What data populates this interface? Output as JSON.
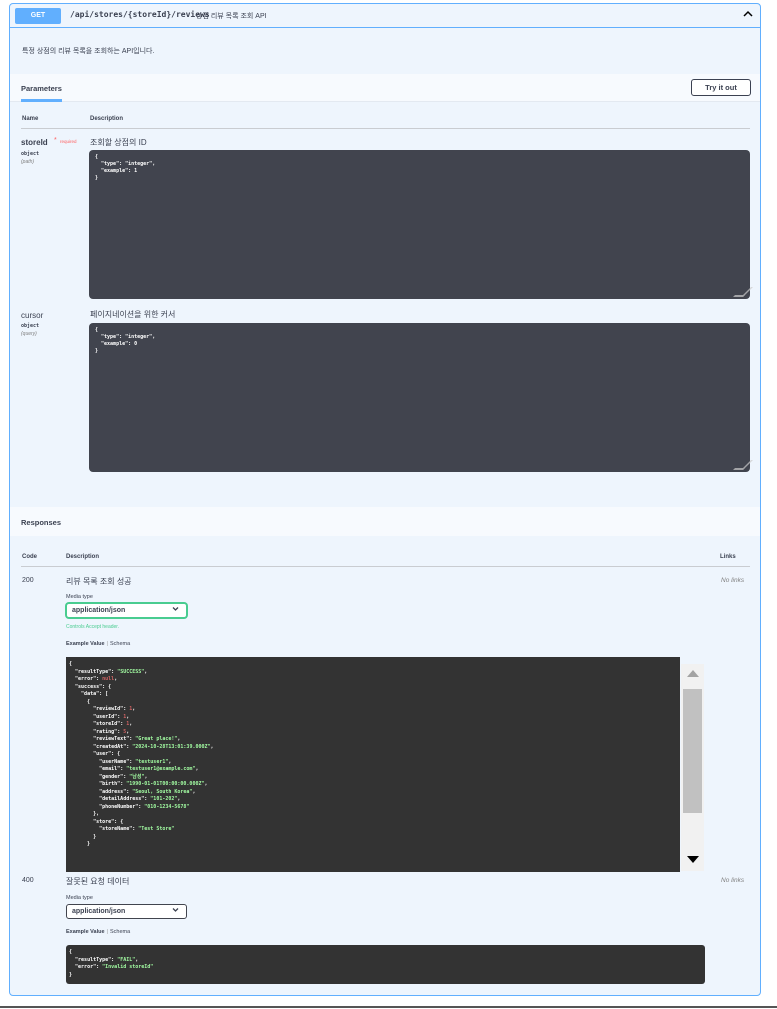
{
  "endpoint": {
    "method": "GET",
    "path": "/api/stores/{storeId}/reviews",
    "summary": "상점 리뷰 목록 조회 API",
    "description": "특정 상점의 리뷰 목록을 조회하는 API입니다."
  },
  "parameters": {
    "tab_label": "Parameters",
    "try_button": "Try it out",
    "col_name": "Name",
    "col_description": "Description",
    "items": [
      {
        "name": "storeId",
        "required_marker": "*",
        "required_label": "required",
        "type": "object",
        "in": "(path)",
        "description": "조회할 상점의 ID",
        "schema_lines": [
          "{",
          "  \"type\": \"integer\",",
          "  \"example\": 1",
          "}"
        ]
      },
      {
        "name": "cursor",
        "type": "object",
        "in": "(query)",
        "description": "페이지네이션을 위한 커서",
        "schema_lines": [
          "{",
          "  \"type\": \"integer\",",
          "  \"example\": 0",
          "}"
        ]
      }
    ]
  },
  "responses": {
    "title": "Responses",
    "col_code": "Code",
    "col_description": "Description",
    "col_links": "Links",
    "items": [
      {
        "code": "200",
        "description": "리뷰 목록 조회 성공",
        "links": "No links",
        "media_type_label": "Media type",
        "media_type": "application/json",
        "accept_note": "Controls Accept header.",
        "example_tab": "Example Value",
        "schema_tab": "Schema"
      },
      {
        "code": "400",
        "description": "잘못된 요청 데이터",
        "links": "No links",
        "media_type_label": "Media type",
        "media_type": "application/json",
        "example_tab": "Example Value",
        "schema_tab": "Schema"
      }
    ]
  },
  "colors": {
    "get_accent": "#61affe",
    "block_bg": "#eef5fd",
    "code_bg": "#333333",
    "string_green": "#a2fca2",
    "number_red": "#d36363"
  }
}
